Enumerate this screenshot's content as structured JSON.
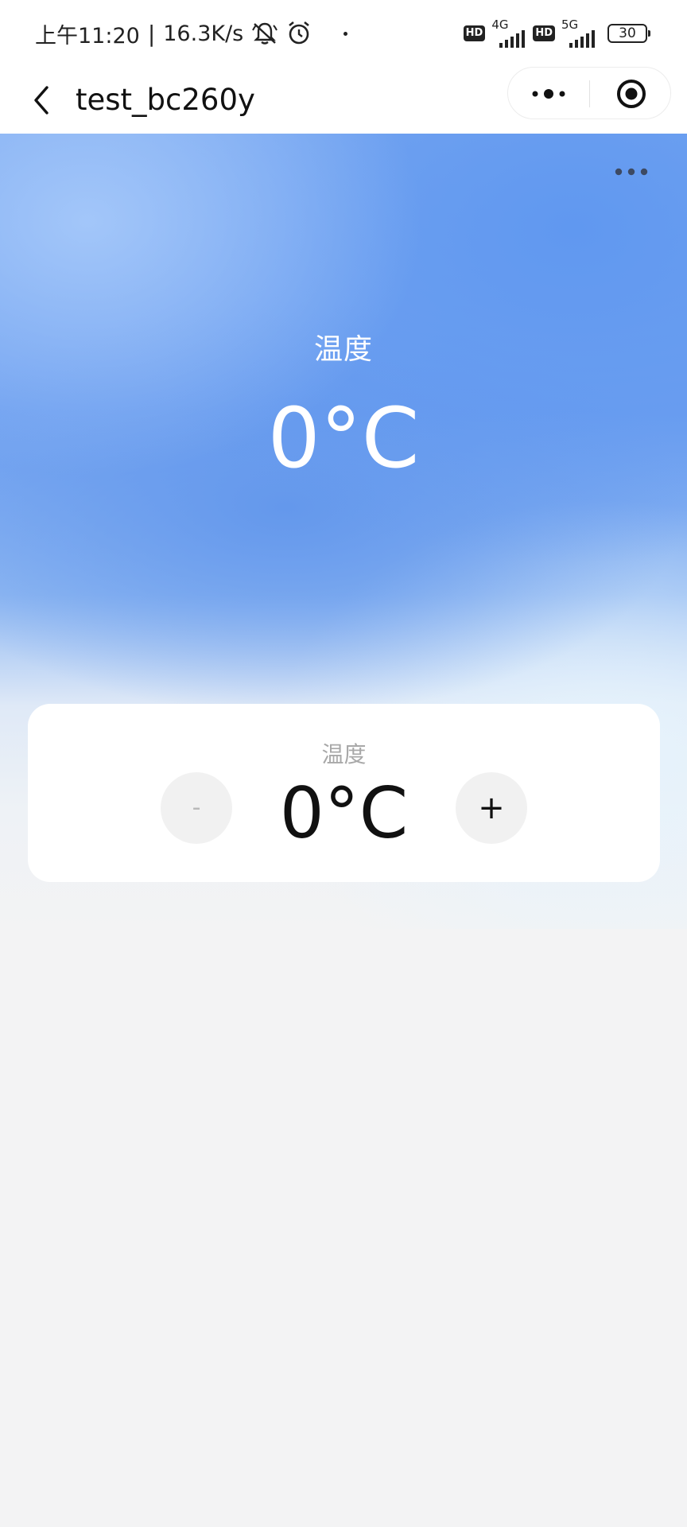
{
  "status_bar": {
    "time": "上午11:20",
    "separator": "|",
    "speed": "16.3K/s",
    "icons": [
      "mute-bell-icon",
      "alarm-icon",
      "dot-icon"
    ],
    "hd1": "HD",
    "net1": "4G",
    "hd2": "HD",
    "net2": "5G",
    "battery": "30"
  },
  "nav": {
    "title": "test_bc260y",
    "back_icon": "chevron-left-icon",
    "more_icon": "more-dots-icon",
    "close_icon": "target-circle-icon"
  },
  "hero": {
    "label": "温度",
    "value": "0°C",
    "more_icon": "more-dots-icon"
  },
  "control": {
    "label": "温度",
    "value": "0°C",
    "minus_label": "-",
    "plus_label": "+"
  },
  "colors": {
    "hero_blue": "#6d9ff0",
    "page_bg": "#f3f3f4",
    "card_bg": "#ffffff",
    "muted_text": "#a8a8a8"
  }
}
